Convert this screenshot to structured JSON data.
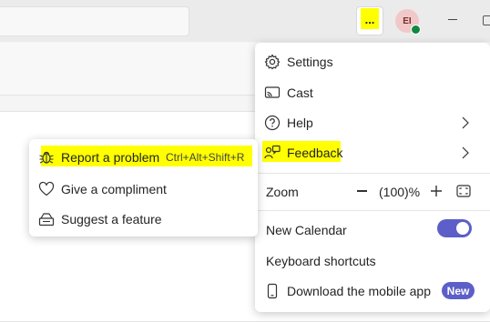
{
  "titlebar": {
    "more_label": "...",
    "avatar_initials": "EI",
    "avatar_status": "available"
  },
  "menu": {
    "settings": "Settings",
    "cast": "Cast",
    "help": "Help",
    "feedback": "Feedback",
    "zoom_label": "Zoom",
    "zoom_value": "(100)%",
    "new_calendar": "New Calendar",
    "new_calendar_on": true,
    "keyboard_shortcuts": "Keyboard shortcuts",
    "download_app": "Download the mobile app",
    "new_badge": "New"
  },
  "submenu": {
    "report_problem": "Report a problem",
    "report_shortcut": "Ctrl+Alt+Shift+R",
    "give_compliment": "Give a compliment",
    "suggest_feature": "Suggest a feature"
  },
  "colors": {
    "accent": "#5b5fc7",
    "highlight": "#ffff00",
    "status_green": "#0f8a3d"
  }
}
